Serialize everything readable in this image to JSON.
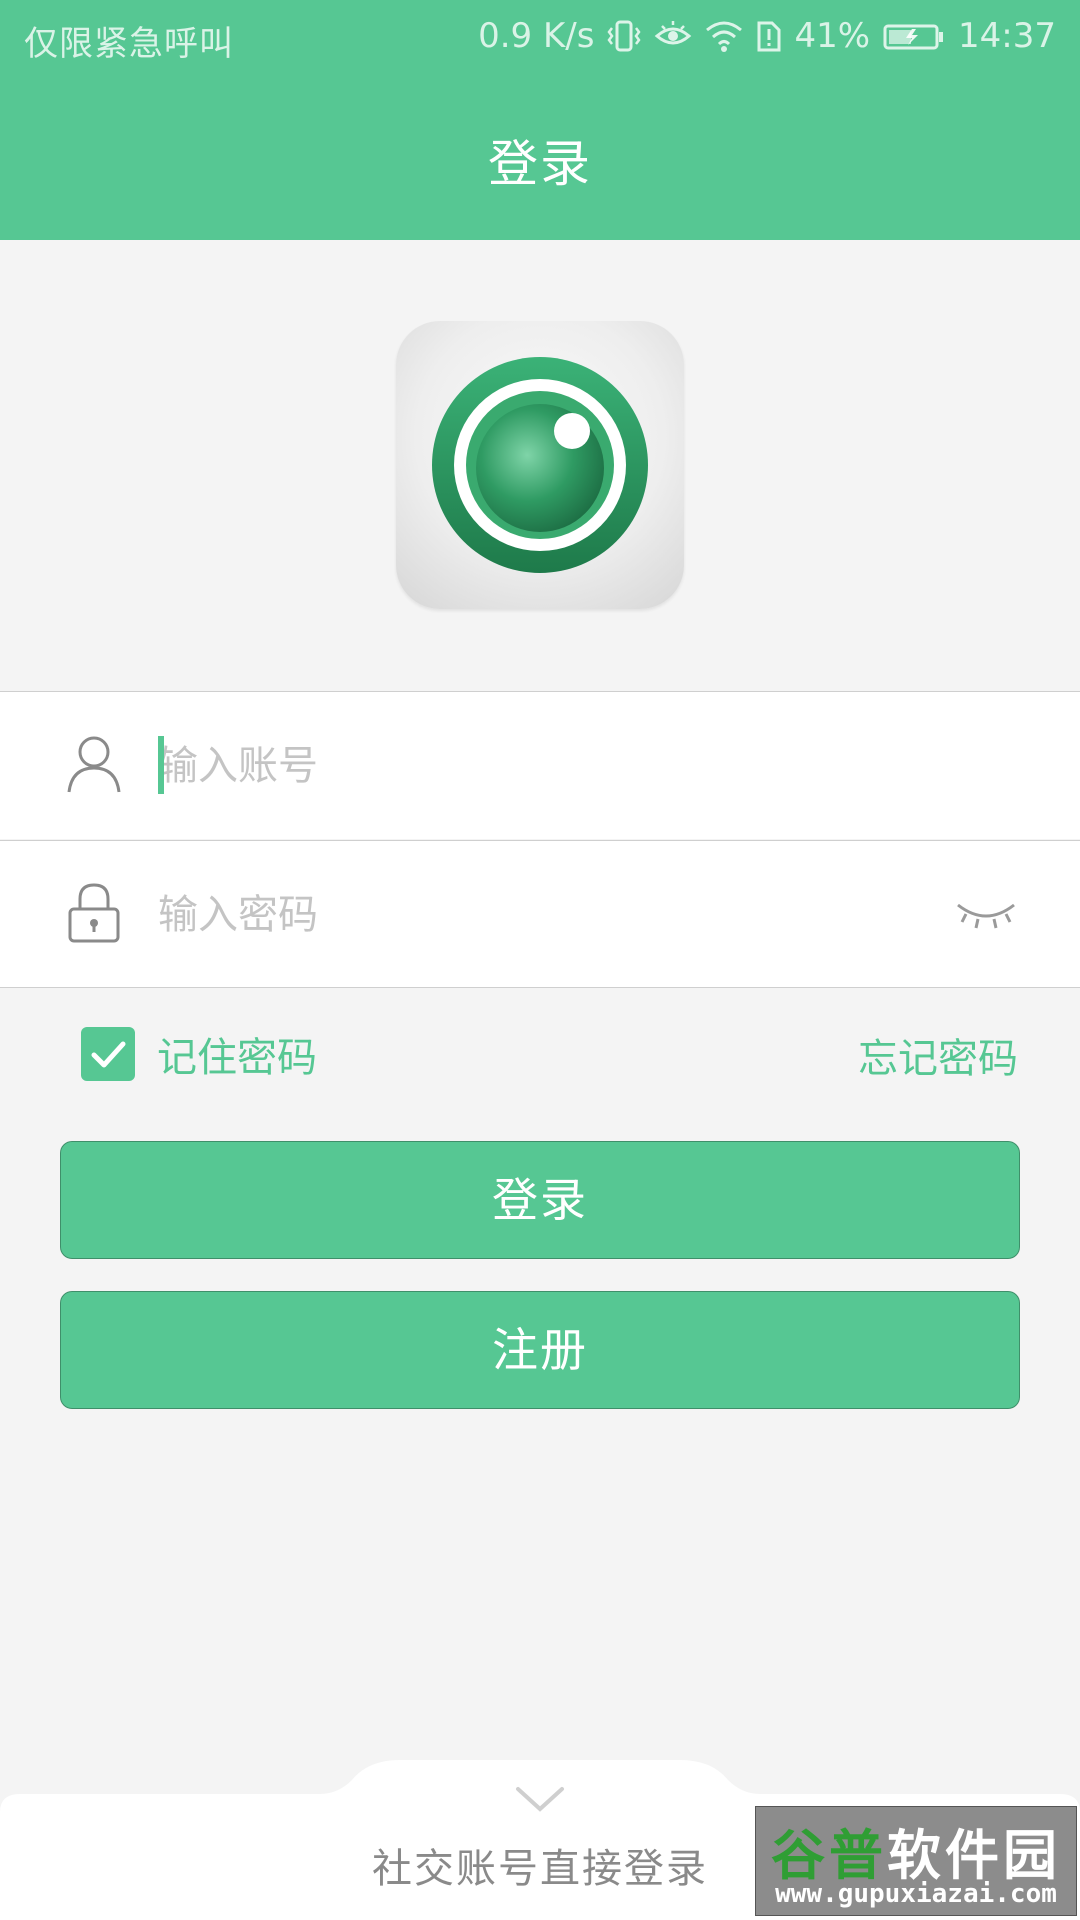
{
  "status_bar": {
    "carrier_text": "仅限紧急呼叫",
    "net_speed": "0.9 K/s",
    "battery_percent": "41%",
    "time": "14:37"
  },
  "header": {
    "title": "登录"
  },
  "login_form": {
    "account_placeholder": "输入账号",
    "password_placeholder": "输入密码",
    "remember_label": "记住密码",
    "remember_checked": true,
    "forgot_label": "忘记密码"
  },
  "buttons": {
    "login_label": "登录",
    "register_label": "注册"
  },
  "social": {
    "label": "社交账号直接登录"
  },
  "watermark": {
    "title_part1": "谷普",
    "title_part2": "软件园",
    "url": "www.gupuxiazai.com"
  },
  "colors": {
    "accent": "#56c793",
    "background": "#f4f4f4",
    "placeholder": "#c4c4c4"
  },
  "icons": {
    "user": "user-icon",
    "lock": "lock-icon",
    "eye_closed": "eye-closed-icon",
    "check": "check-icon",
    "chevron": "chevron-down-icon"
  }
}
